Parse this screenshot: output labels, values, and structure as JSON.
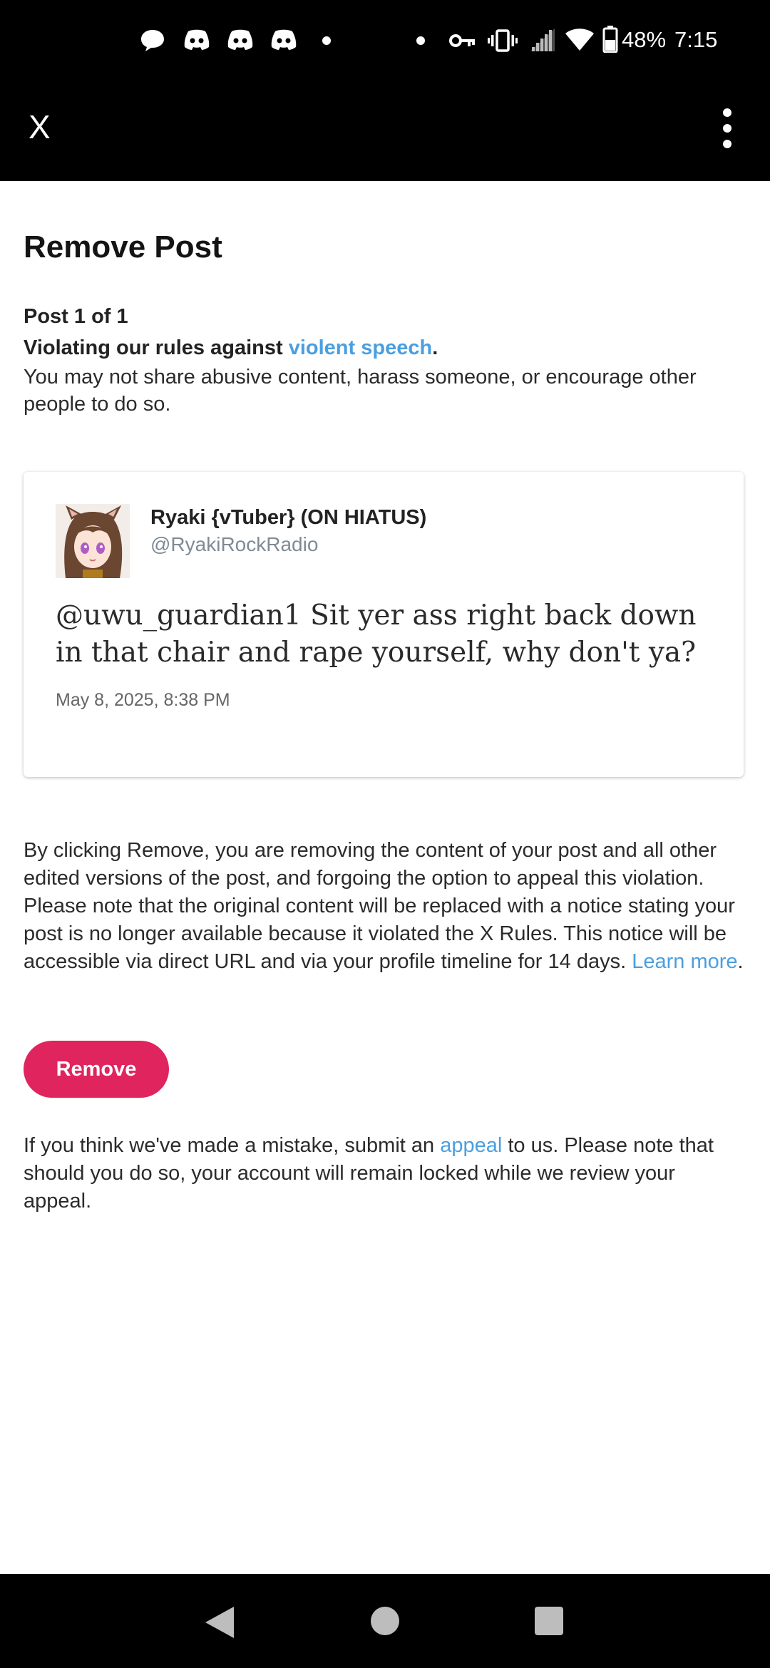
{
  "status_bar": {
    "battery": "48%",
    "time": "7:15",
    "notification_icons": [
      "chat-bubble-icon",
      "discord-icon",
      "discord-icon",
      "discord-icon",
      "dot-icon"
    ],
    "system_icons": [
      "dot-icon",
      "vpn-key-icon",
      "vibrate-icon",
      "signal-icon",
      "wifi-icon",
      "battery-icon"
    ]
  },
  "app_bar": {
    "close_label": "X",
    "more_icon": "more-vert-icon"
  },
  "page": {
    "title": "Remove Post",
    "post_count": "Post 1 of 1",
    "rule_prefix": "Violating our rules against ",
    "rule_link": "violent speech",
    "rule_suffix": ".",
    "rule_description": "You may not share abusive content, harass someone, or encourage other people to do so."
  },
  "post": {
    "author_name": "Ryaki {vTuber} (ON HIATUS)",
    "author_handle": "@RyakiRockRadio",
    "text": "@uwu_guardian1 Sit yer ass right back down in that chair and rape yourself, why don't ya?",
    "date": "May 8, 2025, 8:38 PM"
  },
  "remove_info": {
    "text": "By clicking Remove, you are removing the content of your post and all other edited versions of the post, and forgoing the option to appeal this violation. Please note that the original content will be replaced with a notice stating your post is no longer available because it violated the X Rules. This notice will be accessible via direct URL and via your profile timeline for 14 days. ",
    "link": "Learn more",
    "suffix": "."
  },
  "remove_button": {
    "label": "Remove"
  },
  "appeal_info": {
    "prefix": "If you think we've made a mistake, submit an ",
    "link": "appeal",
    "suffix": " to us. Please note that should you do so, your account will remain locked while we review your appeal."
  },
  "colors": {
    "link": "#4a9fe0",
    "remove_button": "#e0245e",
    "bars": "#000000"
  },
  "nav_bar": {
    "icons": [
      "back-icon",
      "home-icon",
      "recents-icon"
    ]
  }
}
